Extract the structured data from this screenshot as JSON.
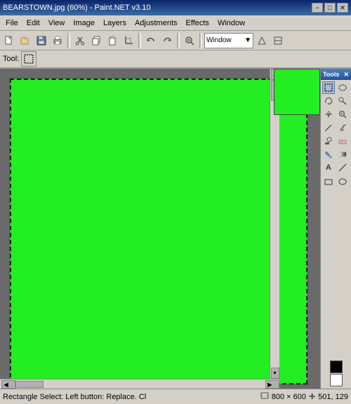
{
  "titleBar": {
    "title": "BEARSTOWN.jpg (60%) - Paint.NET v3.10",
    "minBtn": "−",
    "maxBtn": "□",
    "closeBtn": "✕"
  },
  "menuBar": {
    "items": [
      {
        "label": "File",
        "id": "file"
      },
      {
        "label": "Edit",
        "id": "edit"
      },
      {
        "label": "View",
        "id": "view"
      },
      {
        "label": "Image",
        "id": "image"
      },
      {
        "label": "Layers",
        "id": "layers"
      },
      {
        "label": "Adjustments",
        "id": "adjustments"
      },
      {
        "label": "Effects",
        "id": "effects"
      },
      {
        "label": "Window",
        "id": "window"
      }
    ]
  },
  "toolbar": {
    "windowDropdown": "Window",
    "tools": [
      {
        "icon": "📄",
        "name": "new"
      },
      {
        "icon": "📂",
        "name": "open"
      },
      {
        "icon": "💾",
        "name": "save"
      },
      {
        "icon": "🖨",
        "name": "print"
      },
      {
        "icon": "✂",
        "name": "cut"
      },
      {
        "icon": "📋",
        "name": "copy"
      },
      {
        "icon": "📌",
        "name": "paste"
      },
      {
        "icon": "⬚",
        "name": "crop"
      },
      {
        "icon": "↩",
        "name": "undo"
      },
      {
        "icon": "↪",
        "name": "redo"
      },
      {
        "icon": "🔍",
        "name": "zoom"
      },
      {
        "icon": "⬚",
        "name": "sel"
      }
    ]
  },
  "toolbar2": {
    "toolLabel": "Tool:",
    "toolIcon": "▦"
  },
  "toolsPanel": {
    "title": "Tools",
    "tools": [
      {
        "icon": "▦",
        "name": "rect-select",
        "active": true
      },
      {
        "icon": "◎",
        "name": "ellipse-select"
      },
      {
        "icon": "↖",
        "name": "lasso"
      },
      {
        "icon": "⊕",
        "name": "magic-wand"
      },
      {
        "icon": "✋",
        "name": "move"
      },
      {
        "icon": "↔",
        "name": "zoom-tool"
      },
      {
        "icon": "✏",
        "name": "pencil"
      },
      {
        "icon": "🖌",
        "name": "brush"
      },
      {
        "icon": "◈",
        "name": "clone"
      },
      {
        "icon": "◻",
        "name": "eraser"
      },
      {
        "icon": "🪣",
        "name": "fill"
      },
      {
        "icon": "⬚",
        "name": "gradient"
      },
      {
        "icon": "A",
        "name": "text"
      },
      {
        "icon": "/",
        "name": "line"
      },
      {
        "icon": "□",
        "name": "shapes1"
      },
      {
        "icon": "○",
        "name": "shapes2"
      }
    ]
  },
  "statusBar": {
    "message": "Rectangle Select: Left button: Replace. Cl",
    "sizeIcon": "▣",
    "size": "800 × 600",
    "coordIcon": "✛",
    "coords": "501, 129"
  },
  "canvas": {
    "color": "#22dd22"
  }
}
